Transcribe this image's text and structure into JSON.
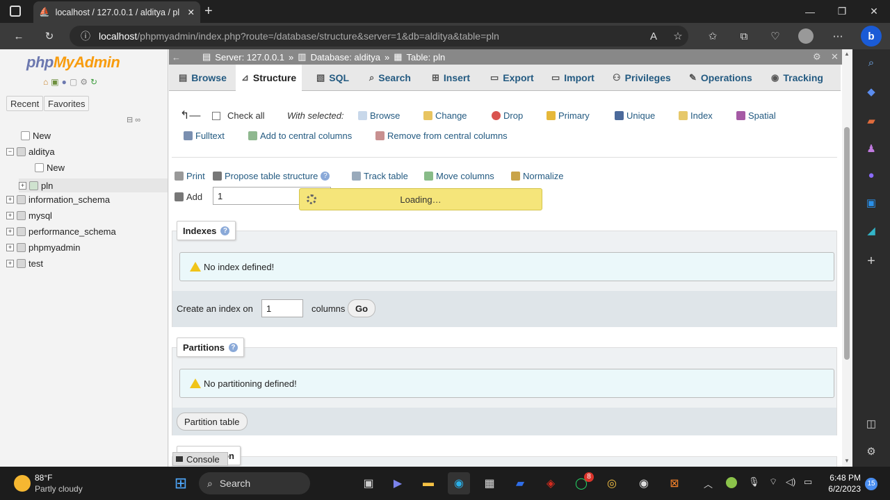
{
  "browser": {
    "tab_title": "localhost / 127.0.0.1 / alditya / pl",
    "url_host": "localhost",
    "url_path": "/phpmyadmin/index.php?route=/database/structure&server=1&db=alditya&table=pln"
  },
  "nav": {
    "logo_php": "php",
    "logo_myadmin": "MyAdmin",
    "recent": "Recent",
    "favorites": "Favorites",
    "tree": [
      {
        "label": "New"
      },
      {
        "label": "alditya"
      },
      {
        "label": "New"
      },
      {
        "label": "pln"
      },
      {
        "label": "information_schema"
      },
      {
        "label": "mysql"
      },
      {
        "label": "performance_schema"
      },
      {
        "label": "phpmyadmin"
      },
      {
        "label": "test"
      }
    ]
  },
  "breadcrumb": {
    "server": "Server: 127.0.0.1",
    "database": "Database: alditya",
    "table": "Table: pln",
    "sep": "»"
  },
  "tabs": [
    "Browse",
    "Structure",
    "SQL",
    "Search",
    "Insert",
    "Export",
    "Import",
    "Privileges",
    "Operations",
    "Tracking"
  ],
  "actions": {
    "check_all": "Check all",
    "with_selected": "With selected:",
    "browse": "Browse",
    "change": "Change",
    "drop": "Drop",
    "primary": "Primary",
    "unique": "Unique",
    "index": "Index",
    "spatial": "Spatial",
    "fulltext": "Fulltext",
    "add_central": "Add to central columns",
    "remove_central": "Remove from central columns"
  },
  "tools": {
    "print": "Print",
    "propose": "Propose table structure",
    "track": "Track table",
    "move": "Move columns",
    "normalize": "Normalize",
    "add": "Add",
    "add_value": "1"
  },
  "loading": "Loading…",
  "indexes": {
    "legend": "Indexes",
    "notice": "No index defined!",
    "create_label": "Create an index on",
    "create_value": "1",
    "columns": "columns",
    "go": "Go"
  },
  "partitions": {
    "legend": "Partitions",
    "notice": "No partitioning defined!",
    "button": "Partition table"
  },
  "next_legend": "on",
  "console": "Console",
  "taskbar": {
    "temp": "88°F",
    "weather": "Partly cloudy",
    "search": "Search",
    "time": "6:48 PM",
    "date": "6/2/2023",
    "badge": "8",
    "notif": "15"
  }
}
